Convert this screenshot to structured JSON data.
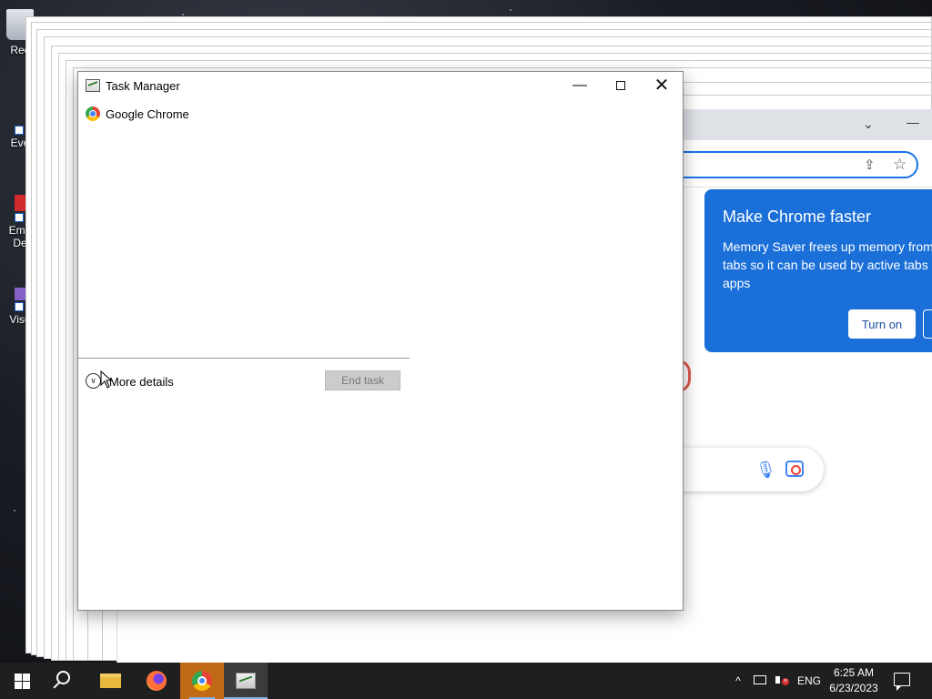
{
  "desktop": {
    "icons": [
      {
        "label": "Rec",
        "name": "recycle-bin"
      },
      {
        "label": "Eve",
        "name": "shortcut-eve"
      },
      {
        "label": "Emb\nDe",
        "name": "shortcut-emb"
      },
      {
        "label": "Visu",
        "name": "shortcut-visual"
      }
    ]
  },
  "chrome": {
    "memory_saver": {
      "title": "Make Chrome faster",
      "body": "Memory Saver frees up memory from tabs so it can be used by active tabs a apps",
      "turn_on_label": "Turn on"
    },
    "icons": {
      "tab_search": "chevron-down-icon",
      "minimize": "minimize-icon",
      "share": "share-icon",
      "bookmark": "star-icon",
      "mic": "mic-icon",
      "lens": "camera-lens-icon"
    }
  },
  "task_manager": {
    "title": "Task Manager",
    "caption_buttons": {
      "minimize": "−",
      "maximize": "☐",
      "close": "✕"
    },
    "processes": [
      {
        "name": "Google Chrome",
        "icon": "chrome-icon"
      }
    ],
    "more_details_label": "More details",
    "end_task_label": "End task"
  },
  "taskbar": {
    "apps": [
      "start",
      "search",
      "file-explorer",
      "firefox",
      "chrome",
      "task-manager"
    ],
    "language": "ENG",
    "time": "6:25 AM",
    "date": "6/23/2023",
    "tray_chevron": "^"
  }
}
